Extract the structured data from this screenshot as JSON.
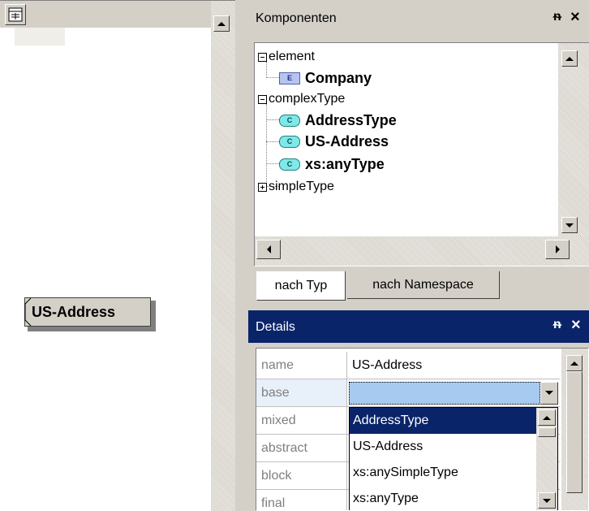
{
  "left_panel": {
    "node_label": "US-Address"
  },
  "components_panel": {
    "title": "Komponenten",
    "pin_icon": "pin-icon",
    "close_icon": "close-icon",
    "tree": [
      {
        "label": "element",
        "expanded": true,
        "children": [
          {
            "badge": "E",
            "label": "Company"
          }
        ]
      },
      {
        "label": "complexType",
        "expanded": true,
        "children": [
          {
            "badge": "C",
            "label": "AddressType"
          },
          {
            "badge": "C",
            "label": "US-Address"
          },
          {
            "badge": "C",
            "label": "xs:anyType"
          }
        ]
      },
      {
        "label": "simpleType",
        "expanded": false
      }
    ],
    "tabs": [
      "nach Typ",
      "nach Namespace"
    ]
  },
  "details_panel": {
    "title": "Details",
    "rows": [
      {
        "key": "name",
        "value": "US-Address"
      },
      {
        "key": "base",
        "value": ""
      },
      {
        "key": "mixed",
        "value": ""
      },
      {
        "key": "abstract",
        "value": ""
      },
      {
        "key": "block",
        "value": ""
      },
      {
        "key": "final",
        "value": ""
      }
    ],
    "dropdown_options": [
      "AddressType",
      "US-Address",
      "xs:anySimpleType",
      "xs:anyType"
    ],
    "dropdown_selected": "AddressType"
  },
  "colors": {
    "title_bar_active": "#0a246a",
    "selection": "#0a246a",
    "base_row_highlight": "#a6caf0",
    "grid_key_text": "#808080"
  }
}
